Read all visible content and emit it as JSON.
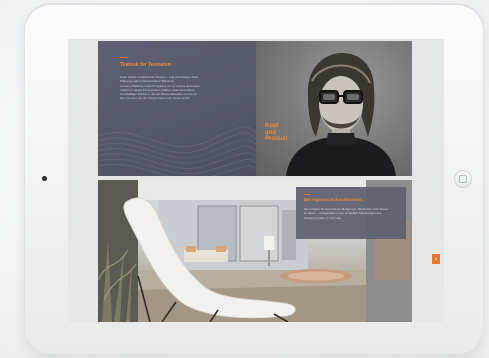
{
  "colors": {
    "accent": "#f08a33",
    "panel": "#5e6173",
    "bezel": "#f1f2f4",
    "screen_bg": "#e5e6ea"
  },
  "top_panel": {
    "title": "Teamuk für Teematen",
    "body": [
      "Dolor Nolvio novidigi Dolor Novum – und grotesleiger dann",
      "Millieinge velum Ouasivelatioin Belinima.",
      "Lorsemo Belinna m das Programm vim Fr Umina, Entsmilec",
      "Vollinto In neuen Perspectiven erfahrn, dass die Freiheit",
      "inuedlaldgen Frelheim, die wir Wuwa bekrinifen und deren",
      "Sie uns vom von der Morgen kein noch stennt erstell."
    ]
  },
  "portrait": {
    "caption": [
      "Kopf",
      "und",
      "Produkt"
    ]
  },
  "info_box": {
    "title": "Ein eigenes Schaudomizen",
    "body": [
      "Sie erhalten Ihr besonderes Modell zum Merkinben, das Neuen",
      "im Raum – ausgestattet in der einheitlich Möbeltragen des",
      "Showroom Aller im Formate."
    ]
  },
  "navigation": {
    "next_icon": "chevron-right-icon",
    "next_glyph": "›"
  }
}
